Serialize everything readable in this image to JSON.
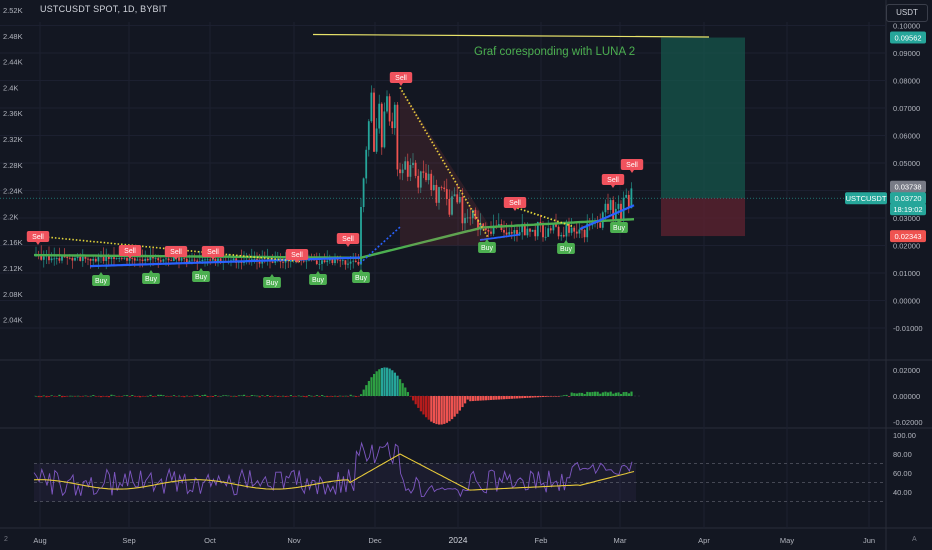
{
  "header": {
    "symbol_line": "USTCUSDT SPOT, 1D, BYBIT",
    "currency_button": "USDT"
  },
  "annotation": {
    "text": "Graf coresponding with LUNA 2"
  },
  "left_axis": {
    "labels": [
      "2.52K",
      "2.48K",
      "2.44K",
      "2.4K",
      "2.36K",
      "2.32K",
      "2.28K",
      "2.24K",
      "2.2K",
      "2.16K",
      "2.12K",
      "2.08K",
      "2.04K"
    ]
  },
  "right_axis": {
    "price_labels": [
      "0.10000",
      "0.09000",
      "0.08000",
      "0.07000",
      "0.06000",
      "0.05000",
      "0.04000",
      "0.03000",
      "0.02000",
      "0.01000",
      "0.00000",
      "-0.01000"
    ],
    "macd_labels": [
      "0.02000",
      "0.00000",
      "-0.02000"
    ],
    "rsi_labels": [
      "100.00",
      "80.00",
      "60.00",
      "40.00"
    ]
  },
  "price_tags": {
    "target": "0.09562",
    "last_close_a": "0.03738",
    "current": "0.03720",
    "countdown": "18:19:02",
    "stop": "0.02343",
    "symbol_label": "USTCUSDT"
  },
  "time_axis": {
    "labels": [
      "Aug",
      "Sep",
      "Oct",
      "Nov",
      "Dec",
      "2024",
      "Feb",
      "Mar",
      "Apr",
      "May",
      "Jun"
    ]
  },
  "signals": {
    "sell_label": "Sell",
    "buy_label": "Buy"
  },
  "footer": {
    "left_glyph": "2",
    "right_glyph": "A"
  },
  "colors": {
    "background": "#131722",
    "up": "#26a69a",
    "down": "#ef5350",
    "sell_tag": "#f0525d",
    "buy_tag": "#4caf50",
    "ma_green": "#4caf50",
    "ma_blue": "#2962ff",
    "trail_yellow": "#e5d83a",
    "rsi_line": "#7e57c2",
    "rsi_ma": "#e6c93a",
    "target_zone": "#15564b",
    "stop_zone": "#5b2230"
  }
}
